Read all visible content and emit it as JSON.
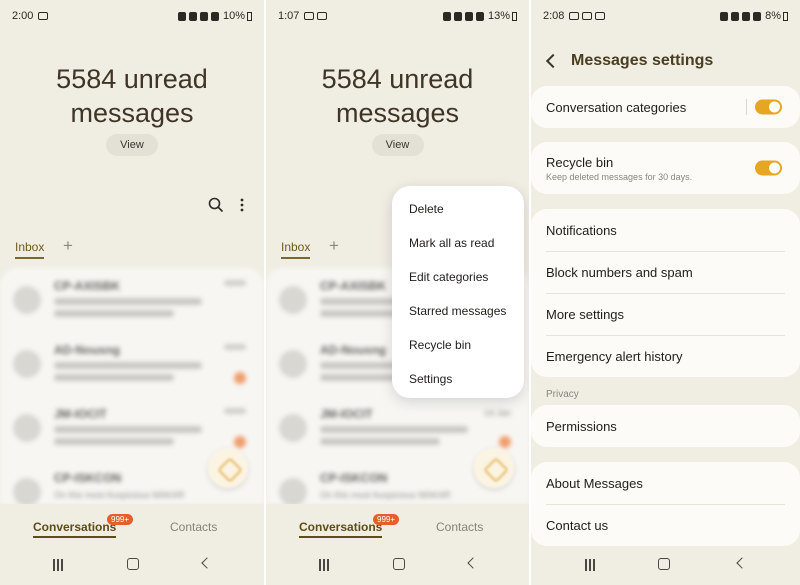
{
  "screen1": {
    "status": {
      "time": "2:00",
      "battery": "10%"
    },
    "headline": {
      "line1": "5584 unread",
      "line2": "messages"
    },
    "view_label": "View",
    "tab_inbox": "Inbox",
    "conversations": [
      {
        "sender": "CP-AXISBK"
      },
      {
        "sender": "AD-Nousng"
      },
      {
        "sender": "JM-IOCIT"
      },
      {
        "sender": "CP-ISKCON",
        "preview": "On this most Auspicious MAKAR"
      }
    ],
    "bottom_nav": {
      "conversations": "Conversations",
      "badge": "999+",
      "contacts": "Contacts"
    }
  },
  "screen2": {
    "status": {
      "time": "1:07",
      "battery": "13%"
    },
    "headline": {
      "line1": "5584 unread",
      "line2": "messages"
    },
    "view_label": "View",
    "tab_inbox": "Inbox",
    "conversations": [
      {
        "sender": "CP-AXISBK"
      },
      {
        "sender": "AD-Nousng"
      },
      {
        "sender": "JM-IOCIT",
        "date": "14 Jan"
      },
      {
        "sender": "CP-ISKCON",
        "preview": "On this most Auspicious MAKAR"
      }
    ],
    "menu": [
      "Delete",
      "Mark all as read",
      "Edit categories",
      "Starred messages",
      "Recycle bin",
      "Settings"
    ],
    "bottom_nav": {
      "conversations": "Conversations",
      "badge": "999+",
      "contacts": "Contacts"
    }
  },
  "screen3": {
    "status": {
      "time": "2:08",
      "battery": "8%"
    },
    "title": "Messages settings",
    "conversation_categories": {
      "label": "Conversation categories",
      "enabled": true
    },
    "recycle_bin": {
      "label": "Recycle bin",
      "sub": "Keep deleted messages for 30 days.",
      "enabled": true
    },
    "group1": [
      "Notifications",
      "Block numbers and spam",
      "More settings",
      "Emergency alert history"
    ],
    "privacy_label": "Privacy",
    "permissions": "Permissions",
    "group2": [
      "About Messages",
      "Contact us"
    ]
  },
  "colors": {
    "accent": "#e6a622",
    "background": "#f0ede3",
    "badge": "#e55f2a"
  }
}
